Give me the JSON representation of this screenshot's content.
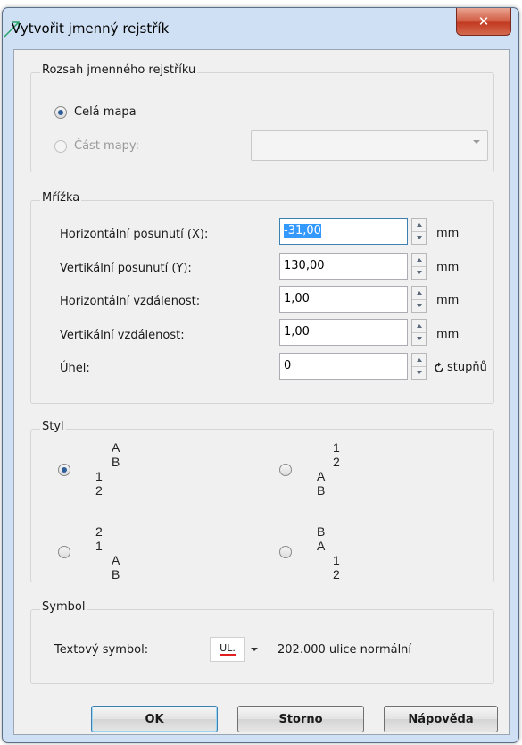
{
  "window": {
    "title": "Vytvořit jmenný rejstřík",
    "close_label": "✕"
  },
  "rozsah": {
    "legend": "Rozsah jmenného rejstříku",
    "option_whole": "Celá mapa",
    "option_part": "Část mapy:",
    "part_value": ""
  },
  "mrizka": {
    "legend": "Mřížka",
    "rows": [
      {
        "label": "Horizontální posunutí (X):",
        "value": "-31,00",
        "unit": "mm"
      },
      {
        "label": "Vertikální posunutí (Y):",
        "value": "130,00",
        "unit": "mm"
      },
      {
        "label": "Horizontální vzdálenost:",
        "value": "1,00",
        "unit": "mm"
      },
      {
        "label": "Vertikální vzdálenost:",
        "value": "1,00",
        "unit": "mm"
      },
      {
        "label": "Úhel:",
        "value": "0",
        "unit": "stupňů"
      }
    ]
  },
  "styl": {
    "legend": "Styl",
    "options": [
      {
        "top": "A B",
        "mid": "1",
        "bot": "2",
        "checked": true
      },
      {
        "top": "1 2",
        "mid": "A",
        "bot": "B",
        "checked": false
      },
      {
        "top": "2",
        "mid": "1",
        "bot": "A B",
        "checked": false
      },
      {
        "top": "B",
        "mid": "A",
        "bot": "1 2",
        "checked": false
      }
    ]
  },
  "symbol": {
    "legend": "Symbol",
    "label": "Textový symbol:",
    "swatch_text": "UL.",
    "name": "202.000 ulice normální"
  },
  "buttons": {
    "ok": "OK",
    "cancel": "Storno",
    "help": "Nápověda"
  }
}
